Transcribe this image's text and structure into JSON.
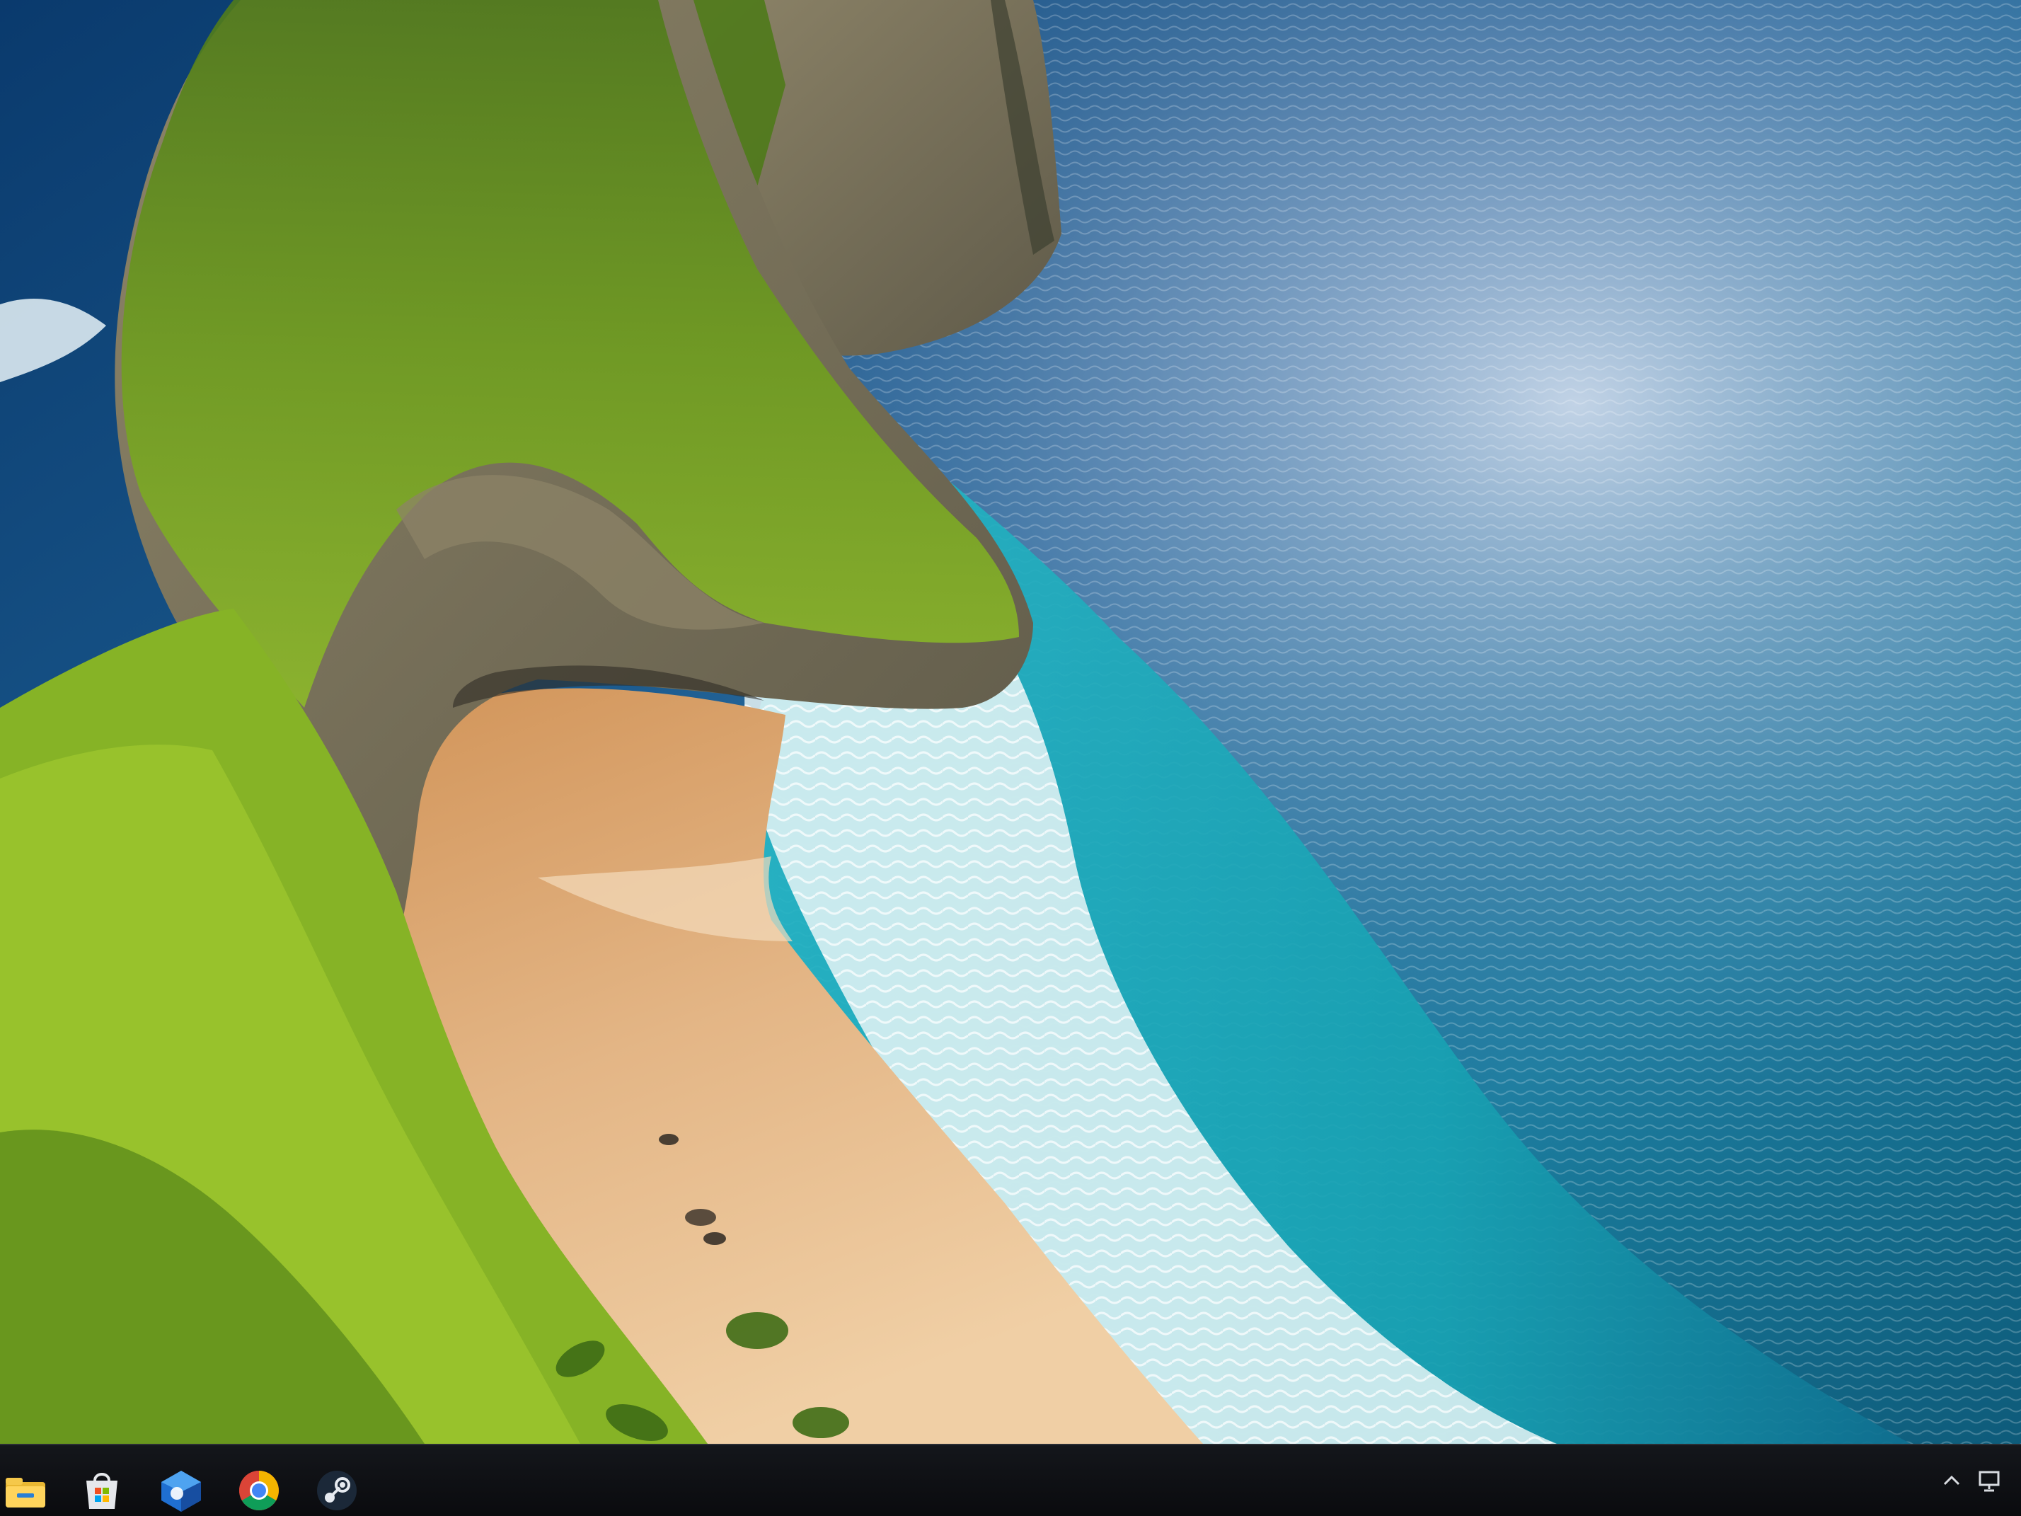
{
  "desktop": {
    "wallpaper": "coastal-cliff-beach",
    "colors": {
      "ocean_deep": "#0d3d6e",
      "ocean_turquoise": "#1aa6b8",
      "foam": "#e9f6f8",
      "sand": "#e0b07e",
      "cliff_green": "#6e9b1f",
      "rock": "#9a8c70"
    }
  },
  "taskbar": {
    "background": "#0d0e12",
    "pinned_apps": [
      {
        "icon": "file-explorer-icon"
      },
      {
        "icon": "microsoft-store-icon"
      },
      {
        "icon": "edge-or-outlook-icon"
      },
      {
        "icon": "chrome-icon"
      },
      {
        "icon": "steam-icon"
      }
    ],
    "tray": {
      "icons": [
        "chevron-up-icon",
        "network-icon"
      ]
    }
  }
}
